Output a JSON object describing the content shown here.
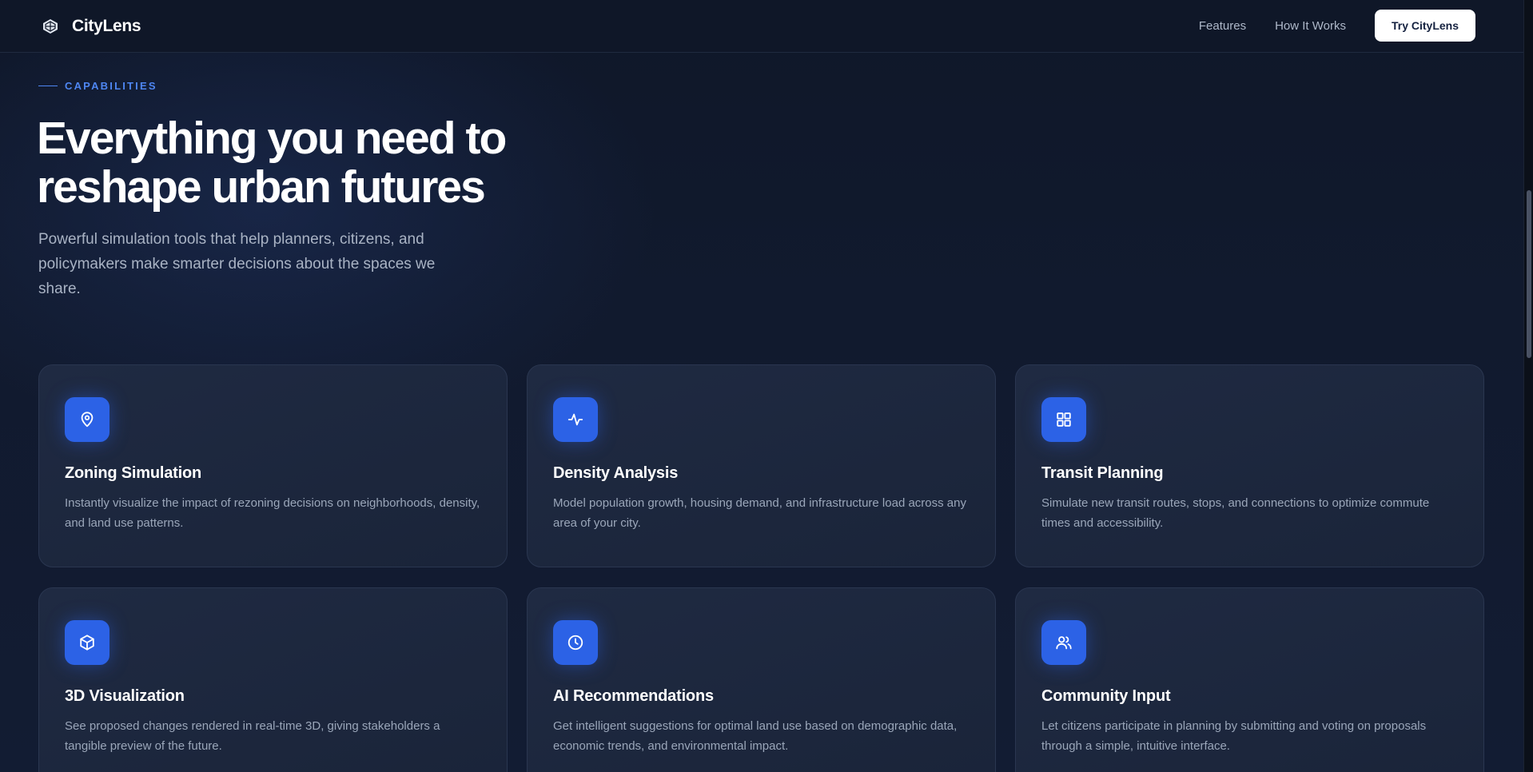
{
  "nav": {
    "brand": "CityLens",
    "links": [
      "Features",
      "How It Works"
    ],
    "cta": "Try CityLens"
  },
  "hero": {
    "eyebrow": "CAPABILITIES",
    "title_line1": "Everything you need to",
    "title_line2": "reshape urban futures",
    "subtitle": "Powerful simulation tools that help planners, citizens, and policymakers make smarter decisions about the spaces we share."
  },
  "features": [
    {
      "icon": "map-pin-icon",
      "title": "Zoning Simulation",
      "desc": "Instantly visualize the impact of rezoning decisions on neighborhoods, density, and land use patterns."
    },
    {
      "icon": "activity-icon",
      "title": "Density Analysis",
      "desc": "Model population growth, housing demand, and infrastructure load across any area of your city."
    },
    {
      "icon": "grid-icon",
      "title": "Transit Planning",
      "desc": "Simulate new transit routes, stops, and connections to optimize commute times and accessibility."
    },
    {
      "icon": "cube-icon",
      "title": "3D Visualization",
      "desc": "See proposed changes rendered in real-time 3D, giving stakeholders a tangible preview of the future."
    },
    {
      "icon": "clock-icon",
      "title": "AI Recommendations",
      "desc": "Get intelligent suggestions for optimal land use based on demographic data, economic trends, and environmental impact."
    },
    {
      "icon": "users-icon",
      "title": "Community Input",
      "desc": "Let citizens participate in planning by submitting and voting on proposals through a simple, intuitive interface."
    }
  ],
  "colors": {
    "background": "#0f1729",
    "card": "#1f2a42",
    "accent": "#2c62e6",
    "eyebrow": "#4e86f2"
  }
}
